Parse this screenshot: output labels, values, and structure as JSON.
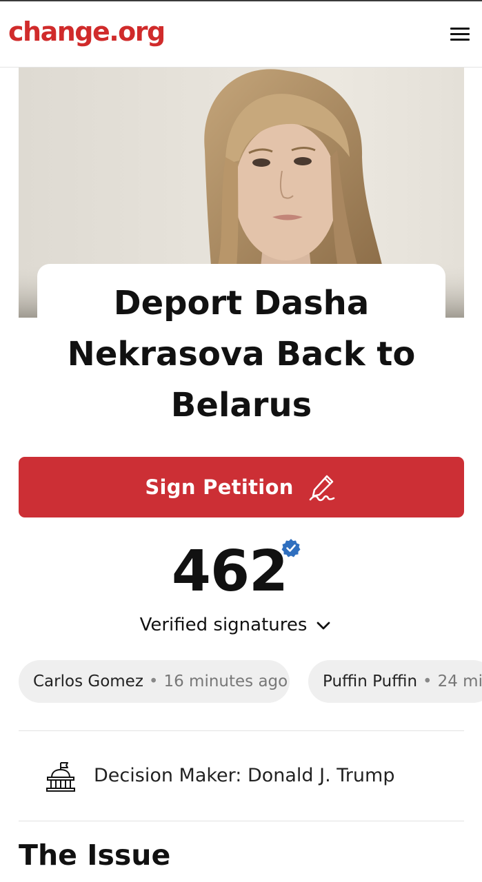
{
  "header": {
    "logo_text": "change.org",
    "menu_icon": "hamburger-menu-icon",
    "brand_color": "#d02b2b"
  },
  "petition": {
    "title_lines": [
      "Deport Dasha",
      "Nekrasova Back to",
      "Belarus"
    ],
    "sign_button_label": "Sign Petition",
    "sign_button_icon": "pen-signature-icon",
    "button_color": "#cc2f35",
    "signature_count": "462",
    "verified_label": "Verified signatures",
    "verified_icon": "verified-badge-icon"
  },
  "recent_signers": [
    {
      "name": "Carlos Gomez",
      "time": "16 minutes ago"
    },
    {
      "name": "Puffin Puffin",
      "time": "24 mi"
    }
  ],
  "decision_maker": {
    "icon": "government-building-icon",
    "label": "Decision Maker: Donald J. Trump"
  },
  "issue": {
    "heading": "The Issue"
  }
}
